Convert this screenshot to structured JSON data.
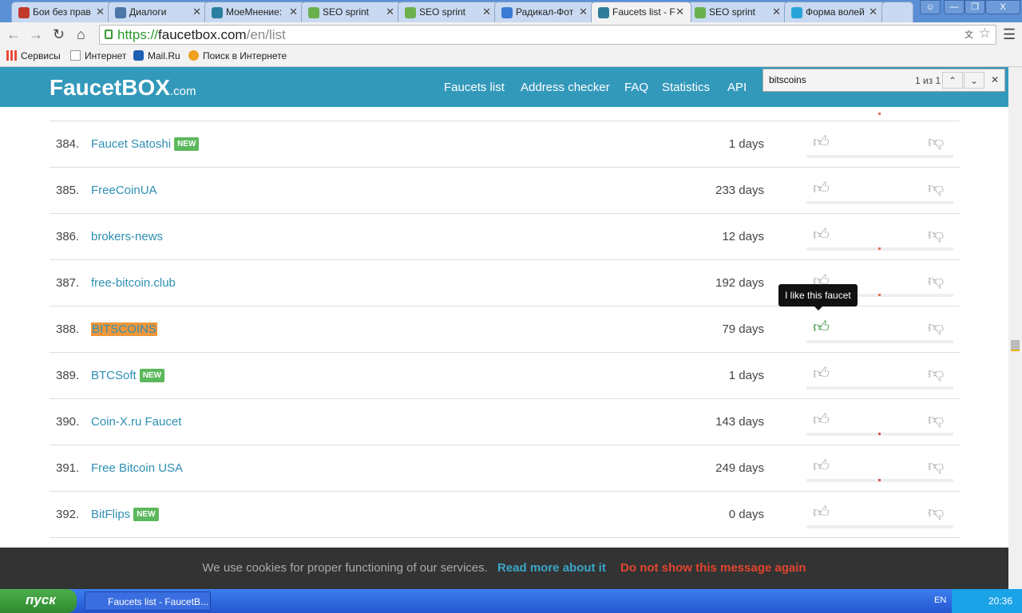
{
  "browser": {
    "tabs": [
      {
        "label": "Бои без прав",
        "color": "#c0392b"
      },
      {
        "label": "Диалоги",
        "color": "#4a76a8"
      },
      {
        "label": "МоеМнение:",
        "color": "#2a7f9e"
      },
      {
        "label": "SEO sprint",
        "color": "#6ab04c"
      },
      {
        "label": "SEO sprint",
        "color": "#6ab04c"
      },
      {
        "label": "Радикал-Фот",
        "color": "#3a7bd5"
      },
      {
        "label": "Faucets list - F",
        "color": "#2e7d99",
        "active": true
      },
      {
        "label": "SEO sprint",
        "color": "#6ab04c"
      },
      {
        "label": "Форма волей",
        "color": "#29a3d9"
      }
    ],
    "url_scheme": "https://",
    "url_host": "faucetbox.com",
    "url_path": "/en/list",
    "bookmarks": [
      "Сервисы",
      "Интернет",
      "Mail.Ru",
      "Поиск в Интернете"
    ],
    "find": {
      "query": "bitscoins",
      "count": "1 из 1"
    }
  },
  "site": {
    "logo": "FaucetBOX",
    "logo_suffix": ".com",
    "nav": [
      "Faucets list",
      "Address checker",
      "FAQ",
      "Statistics",
      "API"
    ],
    "rows": [
      {
        "num": "384.",
        "name": "Faucet Satoshi",
        "badge": "NEW",
        "days": "1 days",
        "marker": null
      },
      {
        "num": "385.",
        "name": "FreeCoinUA",
        "badge": "",
        "days": "233 days",
        "marker": null
      },
      {
        "num": "386.",
        "name": "brokers-news",
        "badge": "",
        "days": "12 days",
        "marker": "#e07050"
      },
      {
        "num": "387.",
        "name": "free-bitcoin.club",
        "badge": "",
        "days": "192 days",
        "marker": "#e07050"
      },
      {
        "num": "388.",
        "name": "BITSCOINS",
        "badge": "",
        "days": "79 days",
        "marker": null,
        "highlight": true,
        "liked": true
      },
      {
        "num": "389.",
        "name": "BTCSoft",
        "badge": "NEW",
        "days": "1 days",
        "marker": null
      },
      {
        "num": "390.",
        "name": "Coin-X.ru Faucet",
        "badge": "",
        "days": "143 days",
        "marker": "#e05050"
      },
      {
        "num": "391.",
        "name": "Free Bitcoin USA",
        "badge": "",
        "days": "249 days",
        "marker": "#e05050"
      },
      {
        "num": "392.",
        "name": "BitFlips",
        "badge": "NEW",
        "days": "0 days",
        "marker": null
      }
    ],
    "tooltip": "I like this faucet",
    "cookie": {
      "text": "We use cookies for proper functioning of our services.",
      "read_more": "Read more about it",
      "dismiss": "Do not show this message again",
      "link_color": "#3aa6c9",
      "dismiss_color": "#e0452e"
    }
  },
  "taskbar": {
    "start": "пуск",
    "task": "Faucets list - FaucetB...",
    "lang": "EN",
    "time": "20:36"
  }
}
